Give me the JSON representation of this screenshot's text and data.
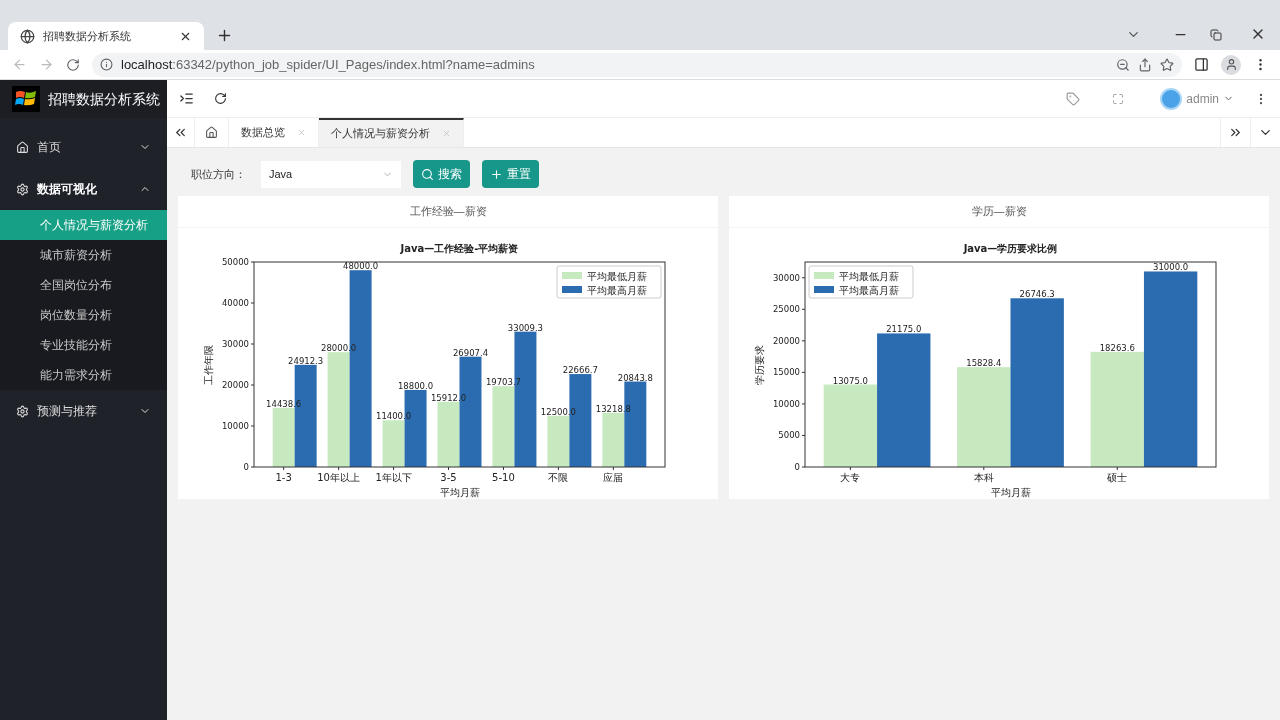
{
  "browser": {
    "tab_title": "招聘数据分析系统",
    "url_host": "localhost",
    "url_rest": ":63342/python_job_spider/UI_Pages/index.html?name=admins"
  },
  "app": {
    "title": "招聘数据分析系统",
    "user": "admin"
  },
  "sidebar": {
    "items": [
      {
        "label": "首页",
        "expanded": false
      },
      {
        "label": "数据可视化",
        "expanded": true,
        "children": [
          {
            "label": "个人情况与薪资分析",
            "selected": true
          },
          {
            "label": "城市薪资分析",
            "selected": false
          },
          {
            "label": "全国岗位分布",
            "selected": false
          },
          {
            "label": "岗位数量分析",
            "selected": false
          },
          {
            "label": "专业技能分析",
            "selected": false
          },
          {
            "label": "能力需求分析",
            "selected": false
          }
        ]
      },
      {
        "label": "预测与推荐",
        "expanded": false
      }
    ]
  },
  "page_tabs": [
    {
      "label": "数据总览",
      "selected": false
    },
    {
      "label": "个人情况与薪资分析",
      "selected": true
    }
  ],
  "filter": {
    "label": "职位方向：",
    "value": "Java",
    "buttons": [
      "搜索",
      "重置"
    ]
  },
  "cards": [
    {
      "title": "工作经验—薪资",
      "chart_data": {
        "type": "bar",
        "title": "Java—工作经验-平均薪资",
        "xlabel": "平均月薪",
        "ylabel": "工作年限",
        "legend": "upper right",
        "categories": [
          "1-3",
          "10年以上",
          "1年以下",
          "3-5",
          "5-10",
          "不限",
          "应届"
        ],
        "series": [
          {
            "name": "平均最低月薪",
            "color": "#c7e9c0",
            "values": [
              14438.6,
              28000,
              11400,
              15912,
              19703.7,
              12500,
              13218.8
            ],
            "value_labels": [
              "14438.6",
              "28000.0",
              "11400.0",
              "15912.0",
              "19703.7",
              "12500.0",
              "13218.8"
            ]
          },
          {
            "name": "平均最高月薪",
            "color": "#2b6cb0",
            "values": [
              24912.3,
              48000,
              18800,
              26907.4,
              33009.3,
              22666.7,
              20843.8
            ],
            "value_labels": [
              "24912.3",
              "48000.0",
              "18800.0",
              "26907.4",
              "33009.3",
              "22666.7",
              "20843.8"
            ]
          }
        ],
        "ylim": [
          0,
          50000
        ],
        "yticks": [
          0,
          10000,
          20000,
          30000,
          40000,
          50000
        ]
      }
    },
    {
      "title": "学历—薪资",
      "chart_data": {
        "type": "bar",
        "title": "Java—学历要求比例",
        "xlabel": "平均月薪",
        "ylabel": "学历要求",
        "legend": "upper left",
        "categories": [
          "大专",
          "本科",
          "硕士"
        ],
        "series": [
          {
            "name": "平均最低月薪",
            "color": "#c7e9c0",
            "values": [
              13075,
              15828.4,
              18263.6
            ],
            "value_labels": [
              "13075.0",
              "15828.4",
              "18263.6"
            ]
          },
          {
            "name": "平均最高月薪",
            "color": "#2b6cb0",
            "values": [
              21175,
              26746.3,
              31000
            ],
            "value_labels": [
              "21175.0",
              "26746.3",
              "31000.0"
            ]
          }
        ],
        "ylim": [
          0,
          32500
        ],
        "yticks": [
          0,
          5000,
          10000,
          15000,
          20000,
          25000,
          30000
        ]
      }
    }
  ]
}
